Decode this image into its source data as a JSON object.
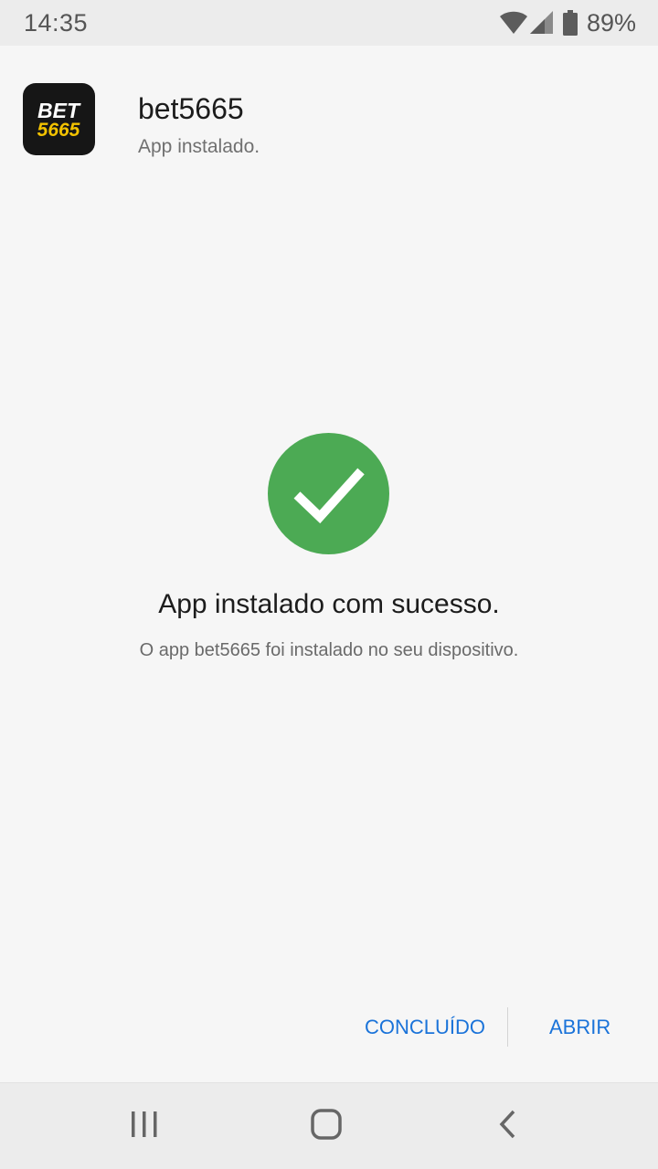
{
  "status_bar": {
    "time": "14:35",
    "battery": "89%",
    "icons": [
      "wifi-icon",
      "signal-icon",
      "battery-icon"
    ]
  },
  "header": {
    "app_name": "bet5665",
    "subtitle": "App instalado.",
    "icon_text_top": "BET",
    "icon_text_bottom": "5665"
  },
  "main": {
    "icon": "check-circle-icon",
    "title": "App instalado com sucesso.",
    "message": "O app bet5665 foi instalado no seu dispositivo."
  },
  "actions": {
    "done_label": "CONCLUÍDO",
    "open_label": "ABRIR"
  },
  "nav_bar": {
    "icons": [
      "recents-icon",
      "home-icon",
      "back-icon"
    ]
  },
  "colors": {
    "accent": "#1a73d9",
    "success": "#4caa54",
    "logo_yellow": "#f2c200",
    "background": "#f6f6f6"
  }
}
